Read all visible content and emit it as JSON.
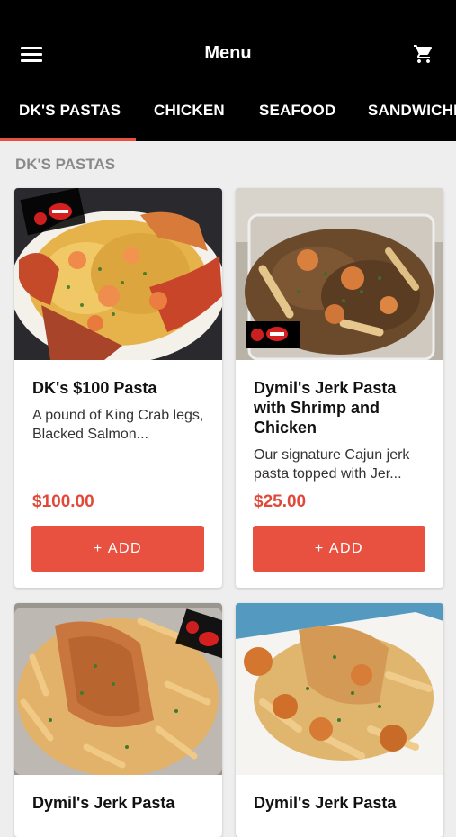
{
  "header": {
    "title": "Menu",
    "menu_icon": "hamburger-menu-icon",
    "cart_icon": "shopping-cart-icon"
  },
  "tabs": [
    {
      "label": "DK'S PASTAS",
      "active": true
    },
    {
      "label": "CHICKEN",
      "active": false
    },
    {
      "label": "SEAFOOD",
      "active": false
    },
    {
      "label": "SANDWICHES",
      "active": false
    }
  ],
  "section": {
    "title": "DK'S PASTAS"
  },
  "items": [
    {
      "name": "DK's $100 Pasta",
      "description": "A pound of King Crab legs, Blacked Salmon...",
      "price": "$100.00",
      "add_label": "+ ADD"
    },
    {
      "name": "Dymil's Jerk Pasta with Shrimp and Chicken",
      "description": "Our signature Cajun jerk pasta topped with Jer...",
      "price": "$25.00",
      "add_label": "+ ADD"
    },
    {
      "name": "Dymil's Jerk Pasta",
      "description": "",
      "price": "",
      "add_label": ""
    },
    {
      "name": "Dymil's Jerk Pasta",
      "description": "",
      "price": "",
      "add_label": ""
    }
  ],
  "colors": {
    "accent": "#e8503f",
    "price": "#e0493a",
    "header_bg": "#000000",
    "page_bg": "#eeeeee"
  }
}
